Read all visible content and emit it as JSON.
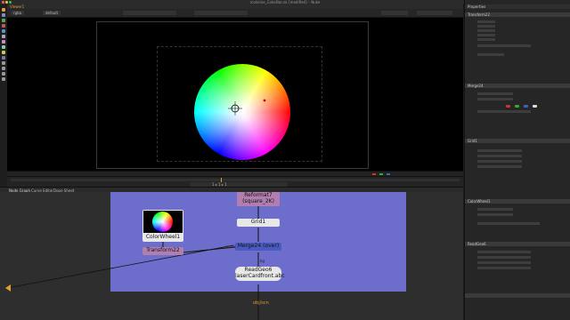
{
  "window": {
    "title": "rcolorize_ColorBar.nk [modified] – Nuke",
    "traffic_lights": [
      "#ff5f56",
      "#ffbd2e",
      "#27c93f"
    ]
  },
  "viewer": {
    "tab": "Viewer1",
    "channels": "rgba",
    "colorspace": "default",
    "frame_info": "1 ▸ 1 ▸ 1"
  },
  "node_graph": {
    "tabs": [
      "Node Graph",
      "Curve Editor",
      "Dope Sheet"
    ],
    "nodes": {
      "reformat": {
        "name": "Reformat7",
        "sub": "(square_2K)"
      },
      "grid": {
        "name": "Grid1"
      },
      "merge": {
        "name": "Merge24 (over)"
      },
      "colorwheel": {
        "name": "ColorWheel1"
      },
      "transform": {
        "name": "Transform22"
      },
      "readgeo": {
        "name": "ReadGeo6",
        "sub": "laserCardfront.abc"
      },
      "mask_label": "mask",
      "bg_label": "bg",
      "output_label": "obj/scn"
    }
  },
  "properties": {
    "title": "Properties",
    "panels": [
      "Transform22",
      "Merge24",
      "Grid1",
      "ColorWheel1",
      "ReadGeo6"
    ],
    "swatch_colors": [
      "#cc3333",
      "#33aa33",
      "#3366cc",
      "#dddddd"
    ]
  }
}
